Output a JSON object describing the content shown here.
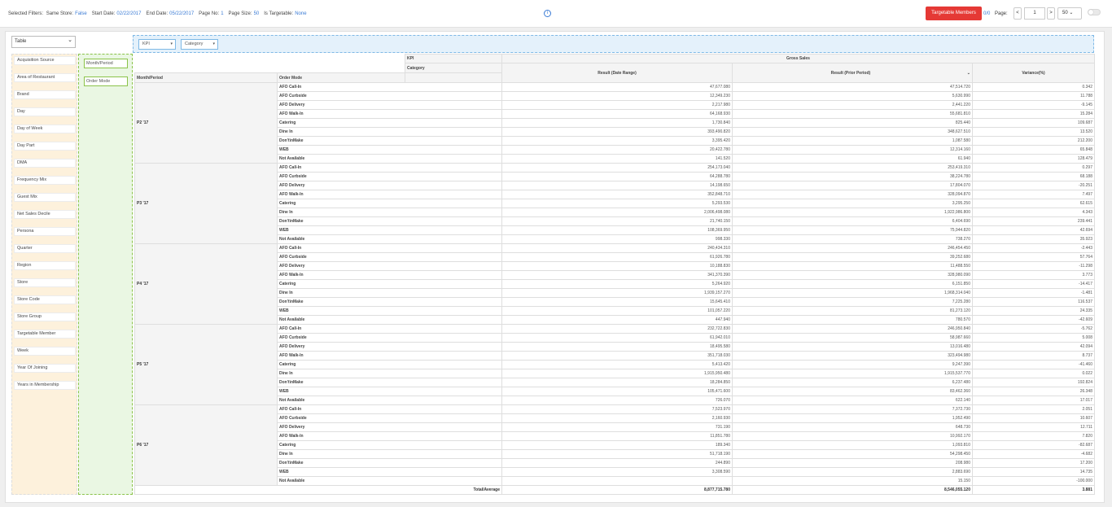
{
  "filters": {
    "label": "Selected Filters:",
    "items": [
      {
        "key": "Same Store:",
        "value": "False"
      },
      {
        "key": "Start Date:",
        "value": "02/22/2017"
      },
      {
        "key": "End Date:",
        "value": "05/22/2017"
      },
      {
        "key": "Page No:",
        "value": "1"
      },
      {
        "key": "Page Size:",
        "value": "50"
      },
      {
        "key": "Is Targetable:",
        "value": "None"
      }
    ]
  },
  "topbar": {
    "info_icon": "info-icon",
    "targetable_button": "Targetable Members",
    "count": "0/0",
    "page_label": "Page:",
    "prev": "<",
    "page_value": "1",
    "next": ">",
    "page_size": "50"
  },
  "pivot": {
    "renderer": "Table",
    "attributes": [
      "Acquisition Source",
      "Area of Restaurant",
      "Brand",
      "Day",
      "Day of Week",
      "Day Part",
      "DMA",
      "Frequency Mix",
      "Guest Mix",
      "Net Sales Decile",
      "Persona",
      "Quarter",
      "Region",
      "Store",
      "Store Code",
      "Store Group",
      "Targetable Member",
      "Week",
      "Year Of Joining",
      "Years in Membership"
    ],
    "row_fields": [
      "Month/Period",
      "Order Mode"
    ],
    "col_fields": [
      "KPI",
      "Category"
    ]
  },
  "table": {
    "kpi_label": "KPI",
    "category_label": "Category",
    "group_header": "Gross Sales",
    "row_header_1": "Month/Period",
    "row_header_2": "Order Mode",
    "col_headers": [
      "Result (Date Range)",
      "Result (Prior Period)",
      "Variance(%)"
    ],
    "periods": [
      {
        "name": "P2 '17",
        "rows": [
          [
            "AFO Call-In",
            "47,677.080",
            "47,514.720",
            "0.342"
          ],
          [
            "AFO Curbside",
            "12,349.230",
            "5,630.990",
            "11.788"
          ],
          [
            "AFO Delivery",
            "2,217.980",
            "2,441.220",
            "-9.145"
          ],
          [
            "AFO Walk-In",
            "64,168.930",
            "55,681.810",
            "15.284"
          ],
          [
            "Catering",
            "1,730.840",
            "825.440",
            "109.687"
          ],
          [
            "Dine In",
            "393,490.820",
            "348,627.510",
            "13.520"
          ],
          [
            "Don't\\nMake",
            "3,395.420",
            "1,087.580",
            "212.200"
          ],
          [
            "WEB",
            "20,422.780",
            "12,314.160",
            "65.848"
          ],
          [
            "Not Available",
            "141.520",
            "61.940",
            "128.479"
          ]
        ]
      },
      {
        "name": "P3 '17",
        "rows": [
          [
            "AFO Call-In",
            "254,173.040",
            "253,419.310",
            "0.297"
          ],
          [
            "AFO Curbside",
            "64,288.780",
            "38,224.780",
            "68.188"
          ],
          [
            "AFO Delivery",
            "14,198.650",
            "17,804.070",
            "-20.251"
          ],
          [
            "AFO Walk-In",
            "352,848.710",
            "328,094.870",
            "7.497"
          ],
          [
            "Catering",
            "5,293.530",
            "3,295.250",
            "62.615"
          ],
          [
            "Dine In",
            "2,006,498.080",
            "1,922,986.800",
            "4.343"
          ],
          [
            "Don't\\nMake",
            "21,740.150",
            "6,404.690",
            "239.441"
          ],
          [
            "WEB",
            "108,369.950",
            "75,944.820",
            "42.694"
          ],
          [
            "Not Available",
            "998.330",
            "738.270",
            "35.923"
          ]
        ]
      },
      {
        "name": "P4 '17",
        "rows": [
          [
            "AFO Call-In",
            "240,434.310",
            "246,454.450",
            "-2.443"
          ],
          [
            "AFO Curbside",
            "61,926.780",
            "39,252.680",
            "57.764"
          ],
          [
            "AFO Delivery",
            "10,188.830",
            "11,488.550",
            "-11.298"
          ],
          [
            "AFO Walk-In",
            "341,370.390",
            "328,980.090",
            "3.773"
          ],
          [
            "Catering",
            "5,264.920",
            "6,151.850",
            "-14.417"
          ],
          [
            "Dine In",
            "1,939,157.270",
            "1,968,314.040",
            "-1.481"
          ],
          [
            "Don't\\nMake",
            "15,645.410",
            "7,225.280",
            "116.537"
          ],
          [
            "WEB",
            "101,057.220",
            "81,273.120",
            "24.335"
          ],
          [
            "Not Available",
            "447.940",
            "780.570",
            "-42.609"
          ]
        ]
      },
      {
        "name": "P5 '17",
        "rows": [
          [
            "AFO Call-In",
            "232,722.830",
            "246,950.840",
            "-5.762"
          ],
          [
            "AFO Curbside",
            "61,942.010",
            "58,987.660",
            "5.008"
          ],
          [
            "AFO Delivery",
            "18,495.580",
            "13,016.480",
            "42.094"
          ],
          [
            "AFO Walk-In",
            "351,718.030",
            "323,494.980",
            "8.737"
          ],
          [
            "Catering",
            "5,413.420",
            "9,247.390",
            "-41.460"
          ],
          [
            "Dine In",
            "1,915,950.480",
            "1,915,537.770",
            "0.022"
          ],
          [
            "Don't\\nMake",
            "18,284.850",
            "6,237.480",
            "192.824"
          ],
          [
            "WEB",
            "105,471.600",
            "83,462.360",
            "26.348"
          ],
          [
            "Not Available",
            "726.070",
            "622.140",
            "17.017"
          ]
        ]
      },
      {
        "name": "P6 '17",
        "rows": [
          [
            "AFO Call-In",
            "7,523.970",
            "7,372.730",
            "2.051"
          ],
          [
            "AFO Curbside",
            "2,160.930",
            "1,952.490",
            "10.607"
          ],
          [
            "AFO Delivery",
            "731.190",
            "648.730",
            "12.711"
          ],
          [
            "AFO Walk-In",
            "11,851.780",
            "10,992.170",
            "7.820"
          ],
          [
            "Catering",
            "189.340",
            "1,093.810",
            "-82.687"
          ],
          [
            "Dine In",
            "51,718.190",
            "54,298.450",
            "-4.682"
          ],
          [
            "Don't\\nMake",
            "244.890",
            "208.980",
            "17.200"
          ],
          [
            "WEB",
            "3,308.590",
            "2,883.690",
            "14.735"
          ],
          [
            "Not Available",
            "",
            "15.150",
            "-100.000"
          ]
        ]
      }
    ],
    "total": {
      "label": "Total/Average",
      "values": [
        "8,877,715.780",
        "8,546,055.120",
        "3.881"
      ]
    }
  }
}
